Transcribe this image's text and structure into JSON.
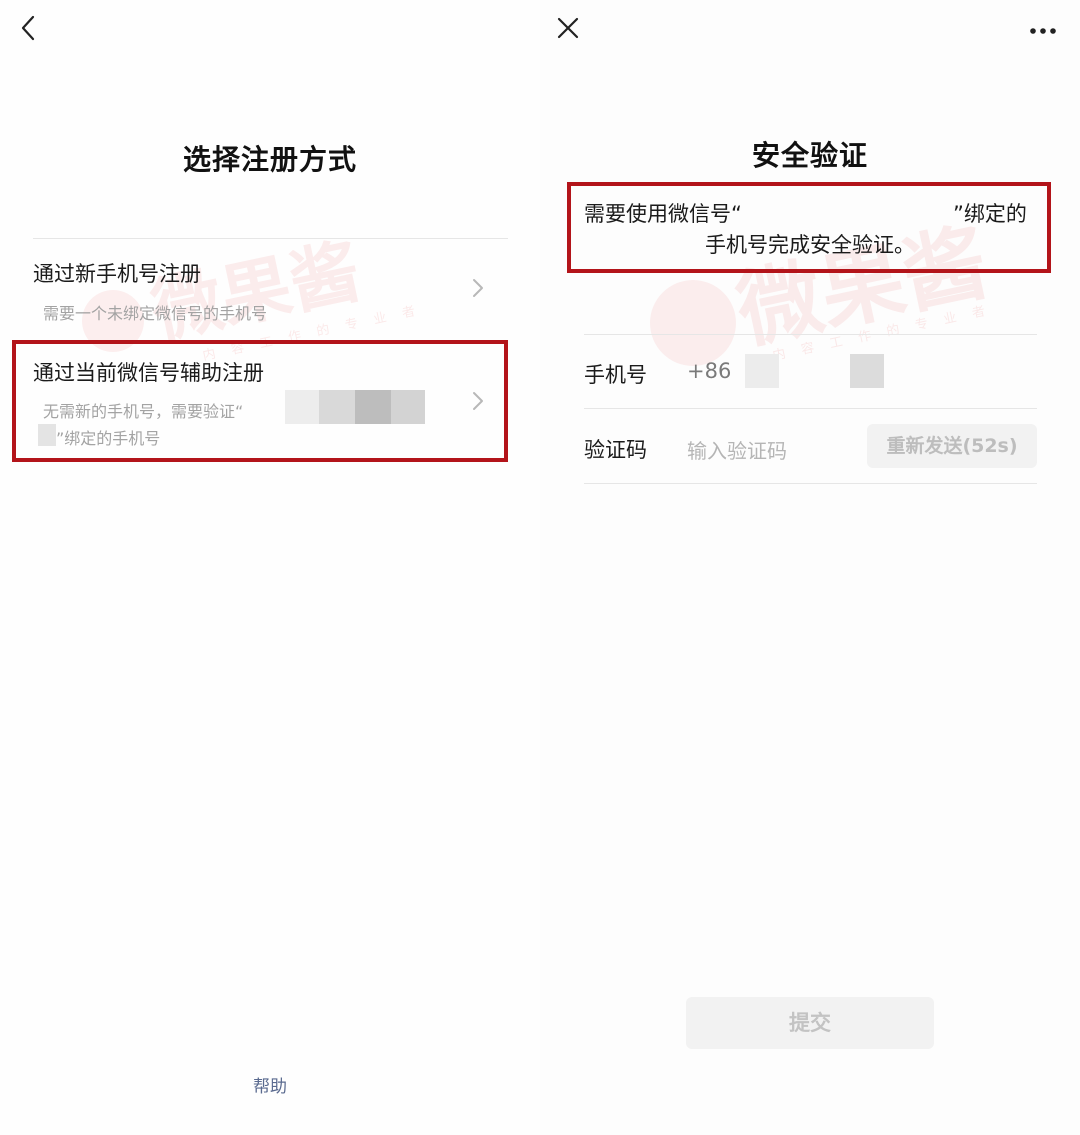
{
  "left": {
    "title": "选择注册方式",
    "options": [
      {
        "title": "通过新手机号注册",
        "subtitle": "需要一个未绑定微信号的手机号"
      },
      {
        "title": "通过当前微信号辅助注册",
        "subtitle_line1": "无需新的手机号，需要验证“",
        "subtitle_line2": "”绑定的手机号"
      }
    ],
    "help": "帮助"
  },
  "right": {
    "title": "安全验证",
    "notice_line1_start": "需要使用微信号“",
    "notice_line1_end": "”绑定的",
    "notice_line2": "手机号完成安全验证。",
    "phone_label": "手机号",
    "country_code": "+86",
    "code_label": "验证码",
    "code_placeholder": "输入验证码",
    "resend_label": "重新发送(52s)",
    "submit_label": "提交"
  },
  "icons": {
    "back": "chevron-left-icon",
    "close": "close-icon",
    "more": "more-dots-icon",
    "row_arrow": "chevron-right-icon"
  },
  "colors": {
    "highlight_box": "#b3141a",
    "link": "#5a6a8f",
    "disabled_button_bg": "#f2f2f2"
  },
  "watermark": {
    "text": "微果酱",
    "tagline": "内 容 工 作 的 专 业 者"
  }
}
